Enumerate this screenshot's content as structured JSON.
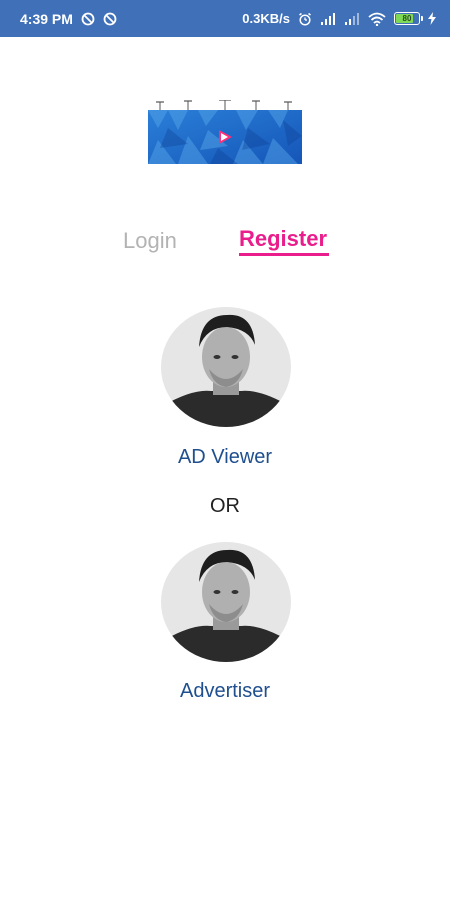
{
  "status_bar": {
    "time": "4:39 PM",
    "network_speed": "0.3KB/s",
    "battery_level": "80",
    "battery_fraction": 0.8
  },
  "tabs": {
    "login_label": "Login",
    "register_label": "Register",
    "active": "register"
  },
  "roles": {
    "viewer_label": "AD Viewer",
    "or_label": "OR",
    "advertiser_label": "Advertiser"
  },
  "colors": {
    "status_bar": "#3f70b8",
    "accent": "#e91e8c",
    "role_text": "#1f4f8f",
    "inactive_tab": "#b3b3b3"
  }
}
